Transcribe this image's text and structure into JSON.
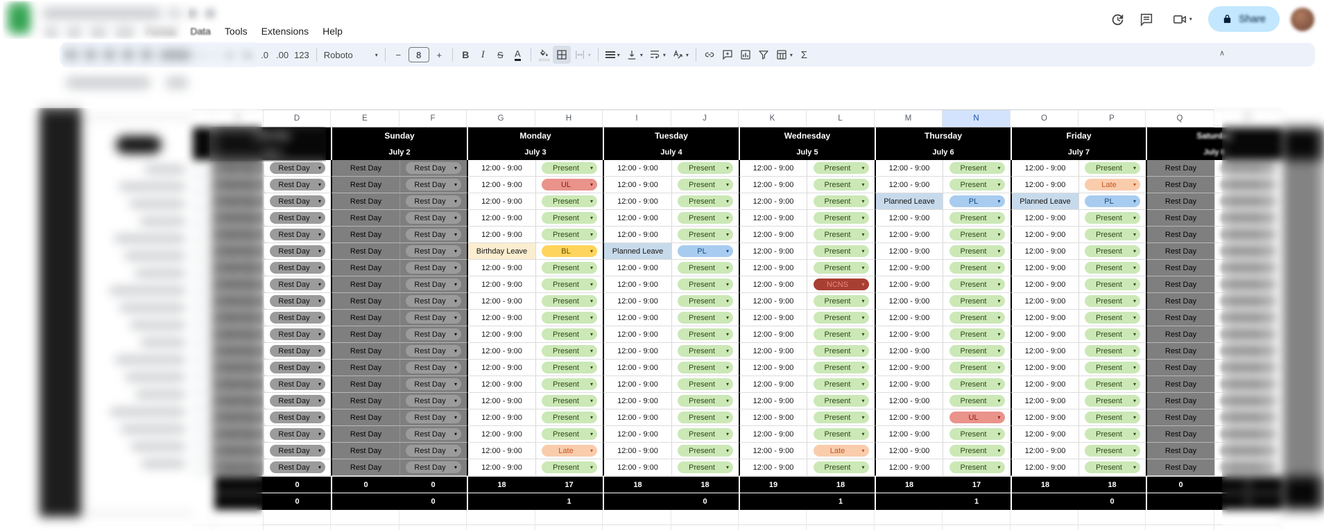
{
  "app": {
    "share_label": "Share"
  },
  "menubar": {
    "format": "Format",
    "data_menu": "Data",
    "tools": "Tools",
    "extensions": "Extensions",
    "help": "Help"
  },
  "toolbar": {
    "currency": "£",
    "percent": "%",
    "decrease_decimal": ".0",
    "increase_decimal": ".00",
    "more_formats": "123",
    "font_name": "Roboto",
    "font_size": "8",
    "bold": "B",
    "italic": "I",
    "strikethrough": "S",
    "text_color": "A",
    "functions": "Σ"
  },
  "sheet": {
    "column_letters": [
      "C",
      "D",
      "E",
      "F",
      "G",
      "H",
      "I",
      "J",
      "K",
      "L",
      "M",
      "N",
      "O",
      "P",
      "Q",
      "R"
    ],
    "selected_column": "N",
    "groups": [
      {
        "day": "Saturday",
        "date": "July 1"
      },
      {
        "day": "Sunday",
        "date": "July 2"
      },
      {
        "day": "Monday",
        "date": "July 3"
      },
      {
        "day": "Tuesday",
        "date": "July 4"
      },
      {
        "day": "Wednesday",
        "date": "July 5"
      },
      {
        "day": "Thursday",
        "date": "July 6"
      },
      {
        "day": "Friday",
        "date": "July 7"
      },
      {
        "day": "Saturday",
        "date": "July 8"
      }
    ],
    "rest_label": "Rest Day",
    "shift_time": "12:00 - 9:00",
    "rows": 19,
    "status_columns": {
      "H": [
        "Present",
        "UL",
        "Present",
        "Present",
        "Present",
        "BL",
        "Present",
        "Present",
        "Present",
        "Present",
        "Present",
        "Present",
        "Present",
        "Present",
        "Present",
        "Present",
        "Present",
        "Late",
        "Present"
      ],
      "J": [
        "Present",
        "Present",
        "Present",
        "Present",
        "Present",
        "PL",
        "Present",
        "Present",
        "Present",
        "Present",
        "Present",
        "Present",
        "Present",
        "Present",
        "Present",
        "Present",
        "Present",
        "Present",
        "Present"
      ],
      "L": [
        "Present",
        "Present",
        "Present",
        "Present",
        "Present",
        "Present",
        "Present",
        "NCNS",
        "Present",
        "Present",
        "Present",
        "Present",
        "Present",
        "Present",
        "Present",
        "Present",
        "Present",
        "Late",
        "Present"
      ],
      "N": [
        "Present",
        "Present",
        "PL",
        "Present",
        "Present",
        "Present",
        "Present",
        "Present",
        "Present",
        "Present",
        "Present",
        "Present",
        "Present",
        "Present",
        "Present",
        "UL",
        "Present",
        "Present",
        "Present"
      ],
      "P": [
        "Present",
        "Late",
        "PL",
        "Present",
        "Present",
        "Present",
        "Present",
        "Present",
        "Present",
        "Present",
        "Present",
        "Present",
        "Present",
        "Present",
        "Present",
        "Present",
        "Present",
        "Present",
        "Present"
      ]
    },
    "leave_cells": {
      "G": {
        "5": "Birthday Leave"
      },
      "I": {
        "5": "Planned Leave"
      },
      "M": {
        "2": "Planned Leave"
      },
      "O": {
        "2": "Planned Leave"
      }
    },
    "summary_row1": {
      "C": "",
      "D": "0",
      "E": "0",
      "F": "0",
      "G": "18",
      "H": "17",
      "I": "18",
      "J": "18",
      "K": "19",
      "L": "18",
      "M": "18",
      "N": "17",
      "O": "18",
      "P": "18",
      "Q": "0",
      "R": "0"
    },
    "summary_row2": {
      "C": "",
      "D": "0",
      "E": "",
      "F": "0",
      "G": "",
      "H": "1",
      "I": "",
      "J": "0",
      "K": "",
      "L": "1",
      "M": "",
      "N": "1",
      "O": "",
      "P": "0",
      "Q": "",
      "R": "0"
    }
  },
  "chip_styles": {
    "Present": {
      "bg": "#CBE8B6",
      "fg": "#2C4A16"
    },
    "Rest Day": {
      "bg": "#9B9B9B",
      "fg": "#0F0F0F"
    },
    "UL": {
      "bg": "#E9938B",
      "fg": "#8C1D13"
    },
    "Late": {
      "bg": "#F9CCAC",
      "fg": "#C35523"
    },
    "BL": {
      "bg": "#FFD45C",
      "fg": "#5F4D00"
    },
    "PL": {
      "bg": "#A8CCEF",
      "fg": "#174A7E"
    },
    "NCNS": {
      "bg": "#A93E33",
      "fg": "#EB897F"
    }
  },
  "cell_colors": {
    "Birthday Leave": "#FBEED0",
    "Planned Leave": "#C7DAEB",
    "gray_cell": "#7F7F7F",
    "band": "#000000",
    "selected_header": "#D3E3FD",
    "selection_blue": "#1A73E8",
    "share_pill": "#C2E7FF",
    "toolbar_bg": "#EDF2FA"
  }
}
